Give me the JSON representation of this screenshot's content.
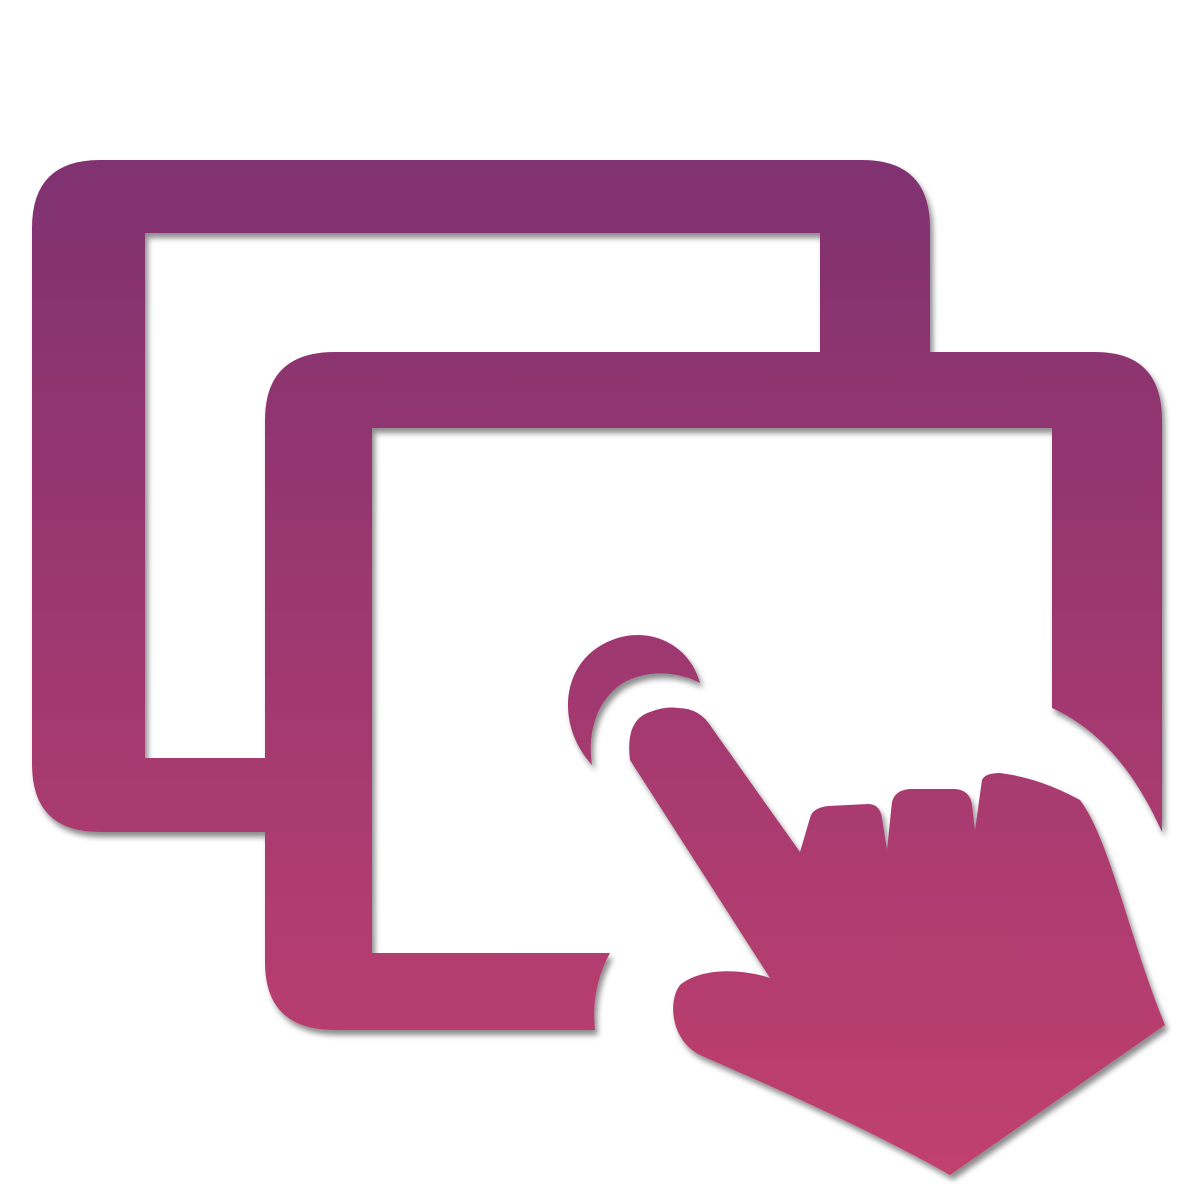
{
  "icon": {
    "name": "multi-screen-touch-icon",
    "colors": {
      "gradient_top": "#7F3171",
      "gradient_bottom": "#C1406E",
      "background": "#ffffff"
    }
  }
}
